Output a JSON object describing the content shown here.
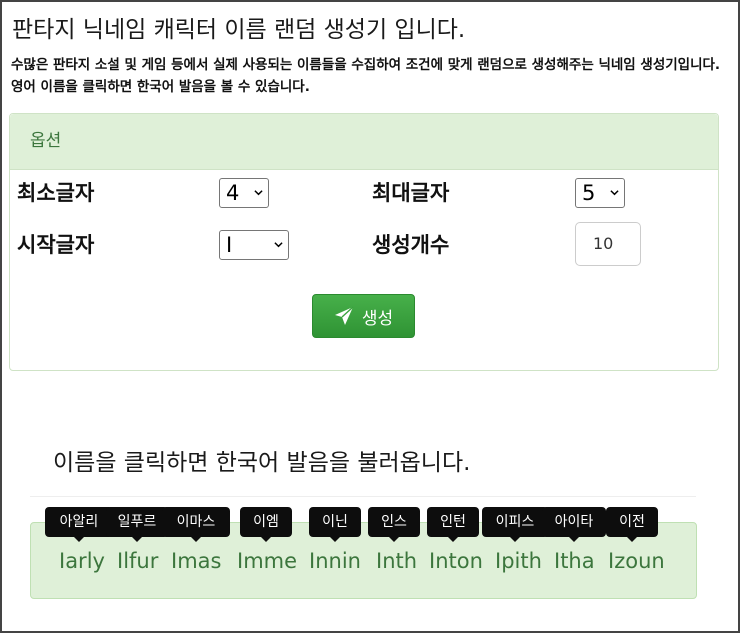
{
  "page": {
    "title": "판타지 닉네임 캐릭터 이름 랜덤 생성기 입니다.",
    "description": "수많은 판타지 소설 및 게임 등에서 실제 사용되는 이름들을 수집하여 조건에 맞게 랜덤으로 생성해주는 닉네임 생성기입니다.영어 이름을 클릭하면 한국어 발음을 볼 수 있습니다."
  },
  "options": {
    "header": "옵션",
    "min_length_label": "최소글자",
    "min_length_value": "4",
    "max_length_label": "최대글자",
    "max_length_value": "5",
    "start_letter_label": "시작글자",
    "start_letter_value": "I",
    "count_label": "생성개수",
    "count_value": "10",
    "generate_label": "생성"
  },
  "results": {
    "hint": "이름을 클릭하면 한국어 발음을 불러옵니다.",
    "names": [
      {
        "name": "Iarly",
        "korean": "아알리"
      },
      {
        "name": "Ilfur",
        "korean": "일푸르"
      },
      {
        "name": "Imas",
        "korean": "이마스"
      },
      {
        "name": "Imme",
        "korean": "이엠"
      },
      {
        "name": "Innin",
        "korean": "이닌"
      },
      {
        "name": "Inth",
        "korean": "인스"
      },
      {
        "name": "Inton",
        "korean": "인턴"
      },
      {
        "name": "Ipith",
        "korean": "이피스"
      },
      {
        "name": "Itha",
        "korean": "아이타"
      },
      {
        "name": "Izoun",
        "korean": "이전"
      }
    ]
  },
  "icons": {
    "generate": "paper-plane-icon",
    "select_arrow": "chevron-down-icon"
  },
  "colors": {
    "panel_header_bg": "#dff0d8",
    "panel_header_text": "#3c763d",
    "button_green": "#3aa33e",
    "tooltip_bg": "#0d0d0d"
  }
}
